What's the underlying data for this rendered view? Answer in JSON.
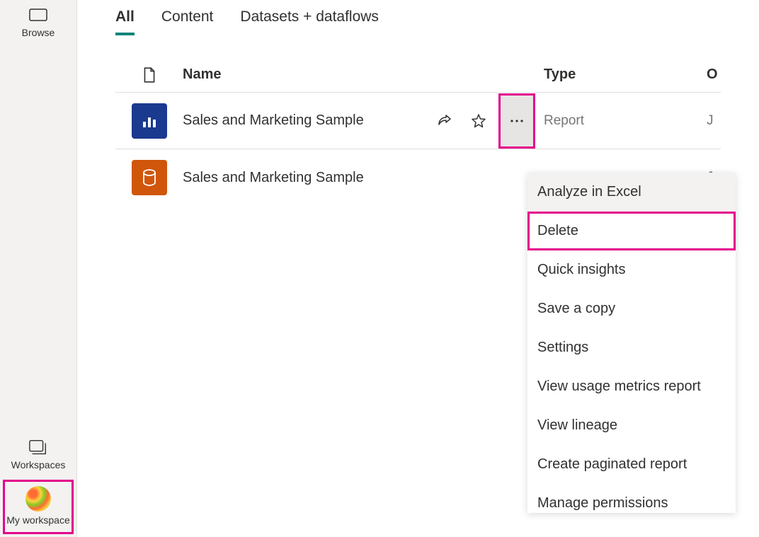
{
  "sidebar": {
    "browse_label": "Browse",
    "workspaces_label": "Workspaces",
    "my_workspace_label": "My workspace"
  },
  "tabs": [
    {
      "label": "All",
      "active": true
    },
    {
      "label": "Content",
      "active": false
    },
    {
      "label": "Datasets + dataflows",
      "active": false
    }
  ],
  "table": {
    "headers": {
      "name": "Name",
      "type": "Type",
      "owner": "O"
    },
    "rows": [
      {
        "name": "Sales and Marketing Sample",
        "type": "Report",
        "owner": "J",
        "icon": "report",
        "show_actions": true
      },
      {
        "name": "Sales and Marketing Sample",
        "type": "",
        "owner": "J",
        "icon": "dataset",
        "show_actions": false
      }
    ]
  },
  "context_menu": {
    "items": [
      "Analyze in Excel",
      "Delete",
      "Quick insights",
      "Save a copy",
      "Settings",
      "View usage metrics report",
      "View lineage",
      "Create paginated report",
      "Manage permissions"
    ]
  }
}
